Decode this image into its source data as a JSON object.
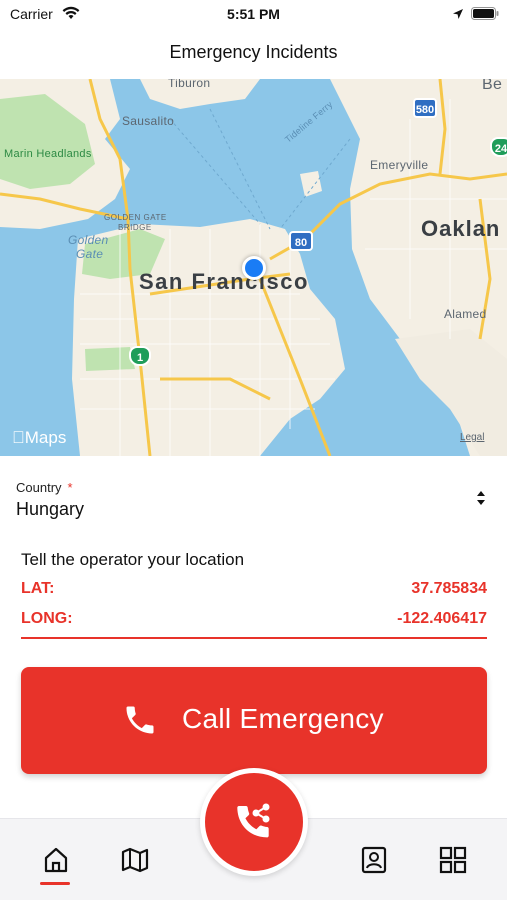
{
  "status_bar": {
    "carrier": "Carrier",
    "time": "5:51 PM",
    "icons": [
      "wifi-icon",
      "location-arrow-icon",
      "battery-icon"
    ]
  },
  "nav": {
    "title": "Emergency Incidents"
  },
  "map": {
    "labels": {
      "tiburon": "Tiburon",
      "sausalito": "Sausalito",
      "marin_headlands": "Marin Headlands",
      "golden_gate_bridge_1": "GOLDEN GATE",
      "golden_gate_bridge_2": "BRIDGE",
      "golden_gate_1": "Golden",
      "golden_gate_2": "Gate",
      "san_francisco": "San Francisco",
      "oakland": "Oaklan",
      "emeryville": "Emeryville",
      "alameda": "Alamed",
      "berkeley": "Be",
      "tideline_ferry": "Tideline Ferry"
    },
    "highways": {
      "i580": "580",
      "i80": "80",
      "sr1": "1",
      "sr24": "24"
    },
    "attribution": "Maps",
    "legal": "Legal",
    "colors": {
      "water": "#8cc6e8",
      "land": "#f4efe4",
      "park": "#bfe3b0",
      "road": "#f6c74a",
      "location_dot": "#1a7cf5"
    }
  },
  "form": {
    "country_label": "Country",
    "required_marker": "*",
    "country_value": "Hungary"
  },
  "location": {
    "prompt": "Tell the operator your location",
    "lat_label": "LAT:",
    "lat_value": "37.785834",
    "long_label": "LONG:",
    "long_value": "-122.406417"
  },
  "call_button": {
    "label": "Call Emergency",
    "icon": "phone-icon"
  },
  "tab_bar": {
    "tabs": [
      {
        "name": "home",
        "icon": "home-icon",
        "active": true
      },
      {
        "name": "map",
        "icon": "map-icon",
        "active": false
      },
      {
        "name": "share-call",
        "icon": "phone-share-icon",
        "active": false
      },
      {
        "name": "contacts",
        "icon": "contact-card-icon",
        "active": false
      },
      {
        "name": "apps",
        "icon": "grid-icon",
        "active": false
      }
    ]
  },
  "theme": {
    "accent": "#e8332a",
    "tab_background": "#f4f4f6"
  }
}
